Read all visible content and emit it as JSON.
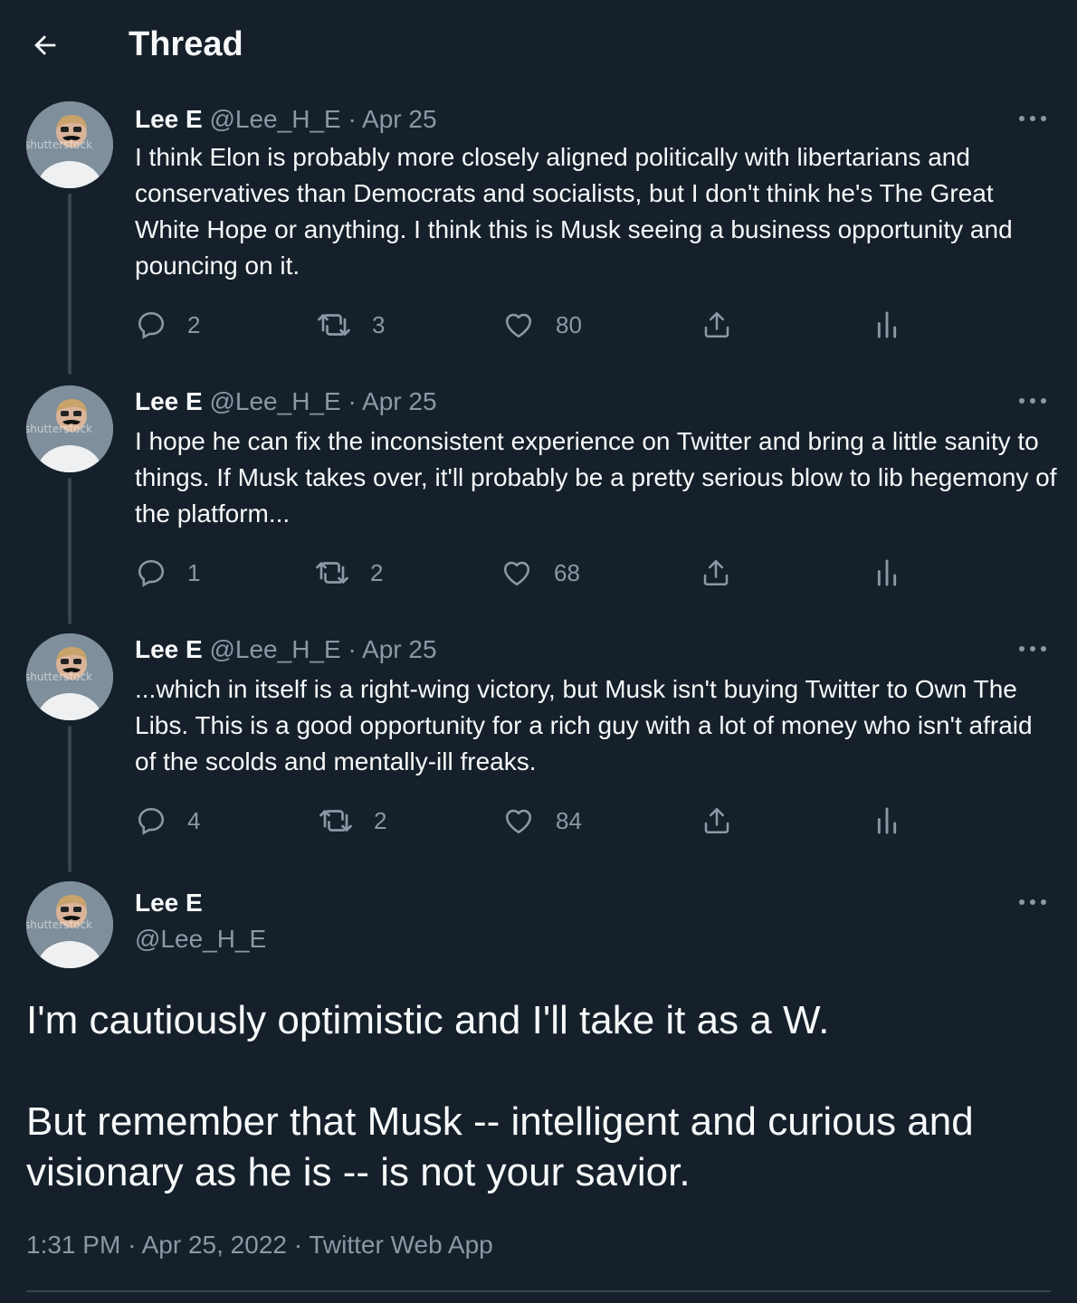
{
  "header": {
    "title": "Thread"
  },
  "tweets": [
    {
      "name": "Lee E",
      "handle": "@Lee_H_E",
      "separator": "·",
      "date": "Apr 25",
      "text": "I think Elon is probably more closely aligned politically with libertarians and conservatives than Democrats and socialists, but I don't think he's The Great White Hope or anything. I think this is Musk seeing a business opportunity and pouncing on it.",
      "replies": "2",
      "retweets": "3",
      "likes": "80"
    },
    {
      "name": "Lee E",
      "handle": "@Lee_H_E",
      "separator": "·",
      "date": "Apr 25",
      "text": "I hope he can fix the inconsistent experience on Twitter and bring a little sanity to things. If Musk takes over, it'll probably be a pretty serious blow to lib hegemony of the platform...",
      "replies": "1",
      "retweets": "2",
      "likes": "68"
    },
    {
      "name": "Lee E",
      "handle": "@Lee_H_E",
      "separator": "·",
      "date": "Apr 25",
      "text": "...which in itself is a right-wing victory, but Musk isn't buying Twitter to Own The Libs. This is a good opportunity for a rich guy with a lot of money who isn't afraid of the scolds and mentally-ill freaks.",
      "replies": "4",
      "retweets": "2",
      "likes": "84"
    }
  ],
  "main_tweet": {
    "name": "Lee E",
    "handle": "@Lee_H_E",
    "paragraph1": "I'm cautiously optimistic and I'll take it as a W.",
    "paragraph2": "But remember that Musk -- intelligent and curious and visionary as he is -- is not your savior.",
    "time": "1:31 PM",
    "separator": "·",
    "date": "Apr 25, 2022",
    "source": "Twitter Web App"
  },
  "avatar_watermark": "shutterstock",
  "colors": {
    "background": "#15202b",
    "text": "#f7f9f9",
    "secondary": "#8b98a5",
    "line": "#38444d"
  },
  "icons": [
    "back-arrow-icon",
    "more-icon",
    "reply-icon",
    "retweet-icon",
    "like-icon",
    "share-icon",
    "analytics-icon"
  ]
}
